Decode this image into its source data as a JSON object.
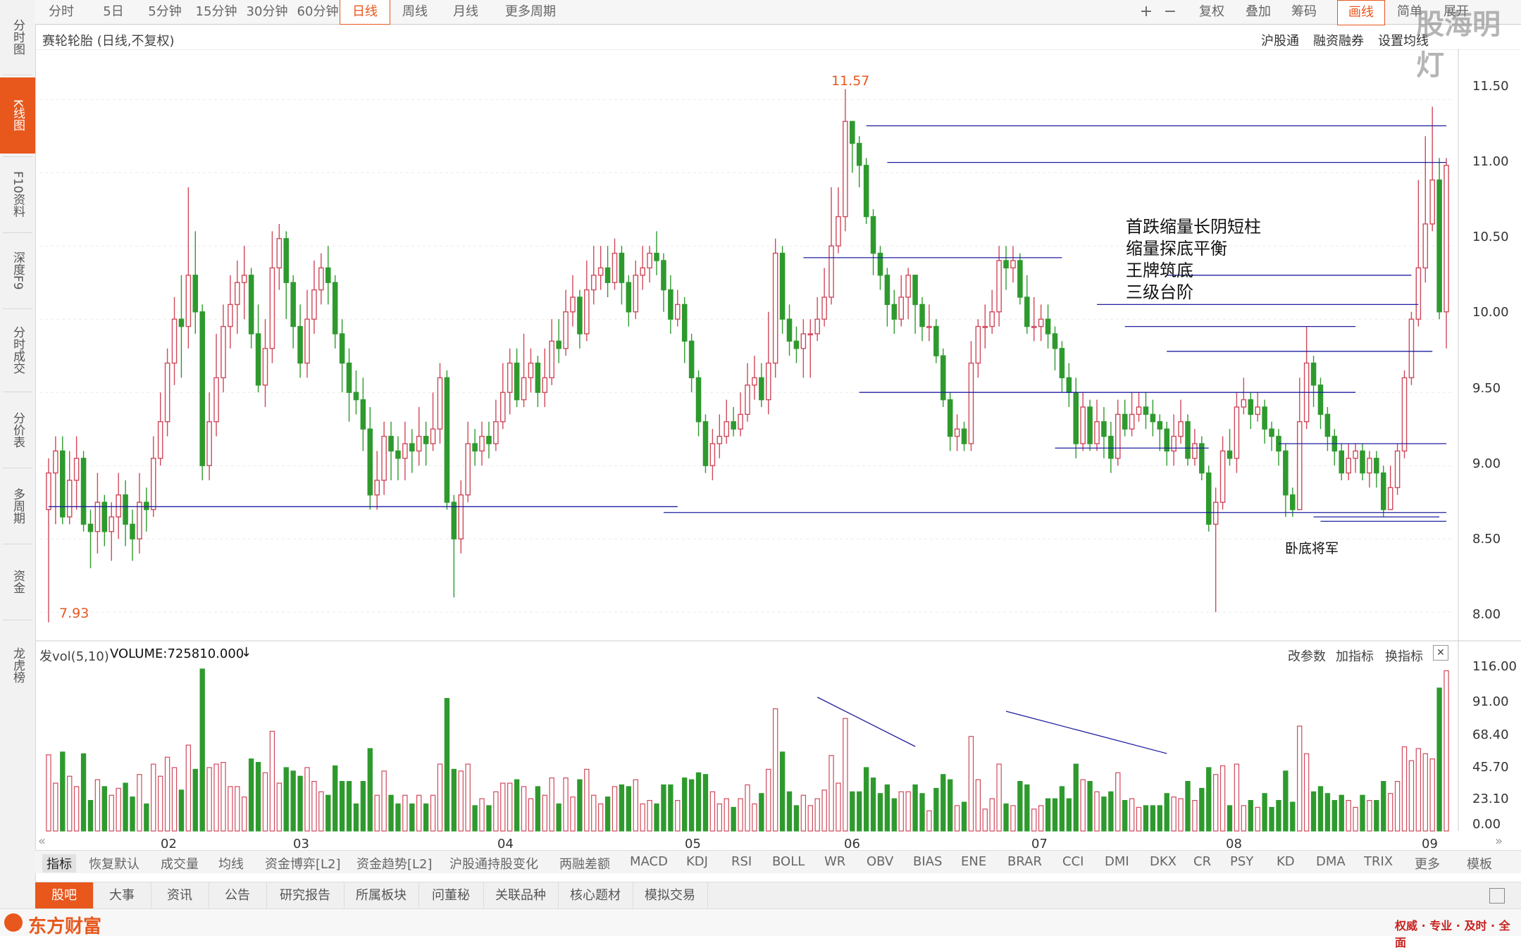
{
  "left_nav": [
    {
      "label": "分时图",
      "active": false
    },
    {
      "label": "K线图",
      "active": true
    },
    {
      "label": "F10资料",
      "active": false
    },
    {
      "label": "深度F9",
      "active": false
    },
    {
      "label": "分时成交",
      "active": false
    },
    {
      "label": "分价表",
      "active": false
    },
    {
      "label": "多周期",
      "active": false
    },
    {
      "label": "资金",
      "active": false
    },
    {
      "label": "龙虎榜",
      "active": false
    }
  ],
  "top_periods": [
    "分时",
    "5日",
    "5分钟",
    "15分钟",
    "30分钟",
    "60分钟",
    "日线",
    "周线",
    "月线",
    "更多周期"
  ],
  "selected_period": "日线",
  "top_tools": [
    "+",
    "−",
    "复权",
    "叠加",
    "筹码",
    "画线",
    "简单",
    "展开"
  ],
  "watermark": "股海明灯",
  "chart_title": "赛轮轮胎 (日线,不复权)",
  "chart_links": [
    "沪股通",
    "融资融券",
    "设置均线"
  ],
  "price_axis": [
    "11.50",
    "11.00",
    "10.50",
    "10.00",
    "9.50",
    "9.00",
    "8.50",
    "8.00"
  ],
  "annotations": {
    "high_marker": "11.57",
    "low_marker": "7.93",
    "notes": [
      "首跌缩量长阴短柱",
      "缩量探底平衡",
      "王牌筑底",
      "三级台阶"
    ],
    "bottom_note": "卧底将军"
  },
  "volume_panel": {
    "title": "发vol(5,10)",
    "value_text": "VOLUME:725810.000",
    "value_arrow": "↓",
    "links": [
      "改参数",
      "加指标",
      "换指标"
    ],
    "close_symbol": "✕",
    "axis": [
      "116.00",
      "91.00",
      "68.40",
      "45.70",
      "23.10",
      "0.00"
    ]
  },
  "x_axis_months": [
    "02",
    "03",
    "04",
    "05",
    "06",
    "07",
    "08",
    "09"
  ],
  "indicator_tabs": [
    "指标",
    "恢复默认",
    "成交量",
    "均线",
    "资金博弈[L2]",
    "资金趋势[L2]",
    "沪股通持股变化",
    "两融差额",
    "MACD",
    "KDJ",
    "RSI",
    "BOLL",
    "WR",
    "OBV",
    "BIAS",
    "ENE",
    "BRAR",
    "CCI",
    "DMI",
    "DKX",
    "CR",
    "PSY",
    "KD",
    "DMA",
    "TRIX",
    "更多",
    "模板"
  ],
  "bottom_tabs": [
    "股吧",
    "大事",
    "资讯",
    "公告",
    "研究报告",
    "所属板块",
    "问董秘",
    "关联品种",
    "核心题材",
    "模拟交易"
  ],
  "footer": {
    "brand": "东方财富",
    "slogan": "权威 · 专业 · 及时 · 全面"
  },
  "colors": {
    "up": "#d0485a",
    "down": "#2e9a2e",
    "accent": "#e8571c",
    "line": "#1f1fa0"
  },
  "chart_data": {
    "type": "candlestick",
    "title": "赛轮轮胎 (日线,不复权)",
    "ylim": [
      7.9,
      11.65
    ],
    "months": [
      "02",
      "03",
      "04",
      "05",
      "06",
      "07",
      "08",
      "09"
    ],
    "candles": [
      [
        8.7,
        8.95,
        9.05,
        7.93
      ],
      [
        8.95,
        9.1,
        9.2,
        8.6
      ],
      [
        9.1,
        8.65,
        9.2,
        8.6
      ],
      [
        8.65,
        8.9,
        9.1,
        8.6
      ],
      [
        8.9,
        9.05,
        9.2,
        8.7
      ],
      [
        9.05,
        8.6,
        9.1,
        8.55
      ],
      [
        8.6,
        8.55,
        8.7,
        8.3
      ],
      [
        8.55,
        8.75,
        8.95,
        8.4
      ],
      [
        8.75,
        8.55,
        8.8,
        8.45
      ],
      [
        8.55,
        8.65,
        8.75,
        8.35
      ],
      [
        8.65,
        8.8,
        8.95,
        8.5
      ],
      [
        8.8,
        8.6,
        8.9,
        8.45
      ],
      [
        8.6,
        8.5,
        8.7,
        8.35
      ],
      [
        8.5,
        8.75,
        8.95,
        8.4
      ],
      [
        8.75,
        8.7,
        8.85,
        8.55
      ],
      [
        8.7,
        9.05,
        9.2,
        8.65
      ],
      [
        9.05,
        9.3,
        9.5,
        9.0
      ],
      [
        9.3,
        9.7,
        9.8,
        9.2
      ],
      [
        9.7,
        10.0,
        10.15,
        9.55
      ],
      [
        10.0,
        9.95,
        10.3,
        9.6
      ],
      [
        9.95,
        10.3,
        10.9,
        9.8
      ],
      [
        10.3,
        10.05,
        10.6,
        9.9
      ],
      [
        10.05,
        9.0,
        10.1,
        8.9
      ],
      [
        9.0,
        9.3,
        9.5,
        8.9
      ],
      [
        9.3,
        9.6,
        9.9,
        9.2
      ],
      [
        9.6,
        9.95,
        10.1,
        9.5
      ],
      [
        9.95,
        10.1,
        10.3,
        9.8
      ],
      [
        10.1,
        10.25,
        10.4,
        9.9
      ],
      [
        10.25,
        10.3,
        10.5,
        10.0
      ],
      [
        10.3,
        9.9,
        10.35,
        9.8
      ],
      [
        9.9,
        9.55,
        10.1,
        9.5
      ],
      [
        9.55,
        9.8,
        10.0,
        9.4
      ],
      [
        9.8,
        10.35,
        10.6,
        9.7
      ],
      [
        10.35,
        10.55,
        10.65,
        10.2
      ],
      [
        10.55,
        10.25,
        10.6,
        10.0
      ],
      [
        10.25,
        9.95,
        10.3,
        9.8
      ],
      [
        9.95,
        9.7,
        10.1,
        9.6
      ],
      [
        9.7,
        10.0,
        10.2,
        9.6
      ],
      [
        10.0,
        10.2,
        10.4,
        9.9
      ],
      [
        10.2,
        10.35,
        10.45,
        10.1
      ],
      [
        10.35,
        10.25,
        10.5,
        10.1
      ],
      [
        10.25,
        9.9,
        10.3,
        9.8
      ],
      [
        9.9,
        9.7,
        10.0,
        9.5
      ],
      [
        9.7,
        9.5,
        9.8,
        9.3
      ],
      [
        9.5,
        9.45,
        9.65,
        9.35
      ],
      [
        9.45,
        9.25,
        9.6,
        9.1
      ],
      [
        9.25,
        8.8,
        9.4,
        8.7
      ],
      [
        8.8,
        8.9,
        9.1,
        8.7
      ],
      [
        8.9,
        9.2,
        9.3,
        8.8
      ],
      [
        9.2,
        9.1,
        9.3,
        8.9
      ],
      [
        9.1,
        9.05,
        9.2,
        8.9
      ],
      [
        9.05,
        9.15,
        9.3,
        8.9
      ],
      [
        9.15,
        9.1,
        9.25,
        8.95
      ],
      [
        9.1,
        9.2,
        9.4,
        9.0
      ],
      [
        9.2,
        9.15,
        9.3,
        9.0
      ],
      [
        9.15,
        9.25,
        9.5,
        9.1
      ],
      [
        9.25,
        9.6,
        9.7,
        9.15
      ],
      [
        9.6,
        8.75,
        9.65,
        8.7
      ],
      [
        8.75,
        8.5,
        8.8,
        8.1
      ],
      [
        8.5,
        8.8,
        8.9,
        8.4
      ],
      [
        8.8,
        9.15,
        9.3,
        8.75
      ],
      [
        9.15,
        9.1,
        9.25,
        9.0
      ],
      [
        9.1,
        9.2,
        9.3,
        9.0
      ],
      [
        9.2,
        9.15,
        9.3,
        9.05
      ],
      [
        9.15,
        9.3,
        9.45,
        9.1
      ],
      [
        9.3,
        9.5,
        9.7,
        9.25
      ],
      [
        9.5,
        9.7,
        9.8,
        9.35
      ],
      [
        9.7,
        9.45,
        9.8,
        9.4
      ],
      [
        9.45,
        9.6,
        9.9,
        9.4
      ],
      [
        9.6,
        9.7,
        9.8,
        9.5
      ],
      [
        9.7,
        9.5,
        9.75,
        9.4
      ],
      [
        9.5,
        9.6,
        9.8,
        9.4
      ],
      [
        9.6,
        9.85,
        10.0,
        9.55
      ],
      [
        9.85,
        9.8,
        10.0,
        9.7
      ],
      [
        9.8,
        10.05,
        10.2,
        9.75
      ],
      [
        10.05,
        10.15,
        10.3,
        9.95
      ],
      [
        10.15,
        9.9,
        10.2,
        9.8
      ],
      [
        9.9,
        10.2,
        10.4,
        9.85
      ],
      [
        10.2,
        10.3,
        10.5,
        10.1
      ],
      [
        10.3,
        10.35,
        10.5,
        10.2
      ],
      [
        10.35,
        10.25,
        10.5,
        10.15
      ],
      [
        10.25,
        10.45,
        10.55,
        10.2
      ],
      [
        10.45,
        10.25,
        10.5,
        10.1
      ],
      [
        10.25,
        10.05,
        10.3,
        9.95
      ],
      [
        10.05,
        10.3,
        10.4,
        10.0
      ],
      [
        10.3,
        10.35,
        10.5,
        10.2
      ],
      [
        10.35,
        10.45,
        10.5,
        10.25
      ],
      [
        10.45,
        10.4,
        10.6,
        10.3
      ],
      [
        10.4,
        10.2,
        10.45,
        10.05
      ],
      [
        10.2,
        10.0,
        10.3,
        9.9
      ],
      [
        10.0,
        10.1,
        10.2,
        9.95
      ],
      [
        10.1,
        9.85,
        10.15,
        9.7
      ],
      [
        9.85,
        9.6,
        9.9,
        9.5
      ],
      [
        9.6,
        9.3,
        9.65,
        9.2
      ],
      [
        9.3,
        9.0,
        9.35,
        8.95
      ],
      [
        9.0,
        9.15,
        9.25,
        8.9
      ],
      [
        9.15,
        9.2,
        9.35,
        9.05
      ],
      [
        9.2,
        9.3,
        9.45,
        9.15
      ],
      [
        9.3,
        9.25,
        9.4,
        9.2
      ],
      [
        9.25,
        9.35,
        9.5,
        9.2
      ],
      [
        9.35,
        9.55,
        9.7,
        9.3
      ],
      [
        9.55,
        9.6,
        9.75,
        9.45
      ],
      [
        9.6,
        9.45,
        9.7,
        9.4
      ],
      [
        9.45,
        9.7,
        10.05,
        9.35
      ],
      [
        9.7,
        10.45,
        10.55,
        9.6
      ],
      [
        10.45,
        10.0,
        10.5,
        9.9
      ],
      [
        10.0,
        9.85,
        10.1,
        9.75
      ],
      [
        9.85,
        9.8,
        9.95,
        9.7
      ],
      [
        9.8,
        9.9,
        10.0,
        9.6
      ],
      [
        9.9,
        9.9,
        10.0,
        9.6
      ],
      [
        9.9,
        10.0,
        10.15,
        9.85
      ],
      [
        10.0,
        10.15,
        10.35,
        9.95
      ],
      [
        10.15,
        10.5,
        10.9,
        10.1
      ],
      [
        10.5,
        10.7,
        10.9,
        10.45
      ],
      [
        10.7,
        11.35,
        11.57,
        10.6
      ],
      [
        11.35,
        11.2,
        11.35,
        11.0
      ],
      [
        11.2,
        11.05,
        11.25,
        10.9
      ],
      [
        11.05,
        10.7,
        11.1,
        10.65
      ],
      [
        10.7,
        10.45,
        10.75,
        10.3
      ],
      [
        10.45,
        10.3,
        10.5,
        10.2
      ],
      [
        10.3,
        10.1,
        10.35,
        9.95
      ],
      [
        10.1,
        10.0,
        10.2,
        9.9
      ],
      [
        10.0,
        10.15,
        10.3,
        9.95
      ],
      [
        10.15,
        10.3,
        10.35,
        10.0
      ],
      [
        10.3,
        10.1,
        10.3,
        9.9
      ],
      [
        10.1,
        9.95,
        10.15,
        9.85
      ],
      [
        9.95,
        9.95,
        10.1,
        9.85
      ],
      [
        9.95,
        9.75,
        10.0,
        9.7
      ],
      [
        9.75,
        9.45,
        9.8,
        9.4
      ],
      [
        9.45,
        9.2,
        9.5,
        9.1
      ],
      [
        9.2,
        9.25,
        9.35,
        9.1
      ],
      [
        9.25,
        9.15,
        9.3,
        9.1
      ],
      [
        9.15,
        9.7,
        9.85,
        9.1
      ],
      [
        9.7,
        9.95,
        10.0,
        9.6
      ],
      [
        9.95,
        9.95,
        10.1,
        9.8
      ],
      [
        9.95,
        10.05,
        10.2,
        9.9
      ],
      [
        10.05,
        10.4,
        10.5,
        9.95
      ],
      [
        10.4,
        10.35,
        10.5,
        10.2
      ],
      [
        10.35,
        10.4,
        10.5,
        10.25
      ],
      [
        10.4,
        10.15,
        10.45,
        10.1
      ],
      [
        10.15,
        9.95,
        10.3,
        9.9
      ],
      [
        9.95,
        9.95,
        10.15,
        9.85
      ],
      [
        9.95,
        10.0,
        10.1,
        9.85
      ],
      [
        10.0,
        9.9,
        10.1,
        9.8
      ],
      [
        9.9,
        9.8,
        9.95,
        9.65
      ],
      [
        9.8,
        9.6,
        9.85,
        9.5
      ],
      [
        9.6,
        9.5,
        9.7,
        9.4
      ],
      [
        9.5,
        9.15,
        9.6,
        9.05
      ],
      [
        9.15,
        9.4,
        9.5,
        9.1
      ],
      [
        9.4,
        9.15,
        9.45,
        9.1
      ],
      [
        9.15,
        9.3,
        9.45,
        9.1
      ],
      [
        9.3,
        9.2,
        9.4,
        9.05
      ],
      [
        9.2,
        9.05,
        9.3,
        8.95
      ],
      [
        9.05,
        9.35,
        9.45,
        9.0
      ],
      [
        9.35,
        9.25,
        9.45,
        9.2
      ],
      [
        9.25,
        9.35,
        9.5,
        9.2
      ],
      [
        9.35,
        9.4,
        9.5,
        9.3
      ],
      [
        9.4,
        9.35,
        9.5,
        9.25
      ],
      [
        9.35,
        9.3,
        9.45,
        9.2
      ],
      [
        9.3,
        9.25,
        9.35,
        9.1
      ],
      [
        9.25,
        9.1,
        9.3,
        9.0
      ],
      [
        9.1,
        9.2,
        9.35,
        9.0
      ],
      [
        9.2,
        9.3,
        9.45,
        9.15
      ],
      [
        9.3,
        9.05,
        9.35,
        9.0
      ],
      [
        9.05,
        9.15,
        9.25,
        9.0
      ],
      [
        9.15,
        8.95,
        9.2,
        8.9
      ],
      [
        8.95,
        8.6,
        9.0,
        8.55
      ],
      [
        8.6,
        8.75,
        8.85,
        8.0
      ],
      [
        8.75,
        9.1,
        9.2,
        8.7
      ],
      [
        9.1,
        9.05,
        9.25,
        9.0
      ],
      [
        9.05,
        9.4,
        9.5,
        8.95
      ],
      [
        9.4,
        9.45,
        9.6,
        9.35
      ],
      [
        9.45,
        9.35,
        9.5,
        9.25
      ],
      [
        9.35,
        9.4,
        9.5,
        9.3
      ],
      [
        9.4,
        9.25,
        9.45,
        9.15
      ],
      [
        9.25,
        9.2,
        9.3,
        9.1
      ],
      [
        9.2,
        9.1,
        9.25,
        9.0
      ],
      [
        9.1,
        8.8,
        9.15,
        8.65
      ],
      [
        8.8,
        8.7,
        8.85,
        8.65
      ],
      [
        8.7,
        9.3,
        9.6,
        8.7
      ],
      [
        9.3,
        9.7,
        9.95,
        9.25
      ],
      [
        9.7,
        9.55,
        9.75,
        9.4
      ],
      [
        9.55,
        9.35,
        9.6,
        9.25
      ],
      [
        9.35,
        9.2,
        9.4,
        9.1
      ],
      [
        9.2,
        9.1,
        9.25,
        9.0
      ],
      [
        9.1,
        8.95,
        9.15,
        8.9
      ],
      [
        8.95,
        9.05,
        9.15,
        8.9
      ],
      [
        9.05,
        9.1,
        9.15,
        8.95
      ],
      [
        9.1,
        8.95,
        9.15,
        8.9
      ],
      [
        8.95,
        9.05,
        9.1,
        8.85
      ],
      [
        9.05,
        8.95,
        9.1,
        8.85
      ],
      [
        8.95,
        8.7,
        9.0,
        8.65
      ],
      [
        8.7,
        8.85,
        9.0,
        8.7
      ],
      [
        8.85,
        9.1,
        9.15,
        8.8
      ],
      [
        9.1,
        9.6,
        9.65,
        9.05
      ],
      [
        9.6,
        10.0,
        10.05,
        9.55
      ],
      [
        10.0,
        10.35,
        10.95,
        9.95
      ],
      [
        10.35,
        10.65,
        11.25,
        10.25
      ],
      [
        10.65,
        10.95,
        11.45,
        10.6
      ],
      [
        10.95,
        10.05,
        11.1,
        10.0
      ],
      [
        10.05,
        11.05,
        11.1,
        9.8
      ]
    ]
  }
}
